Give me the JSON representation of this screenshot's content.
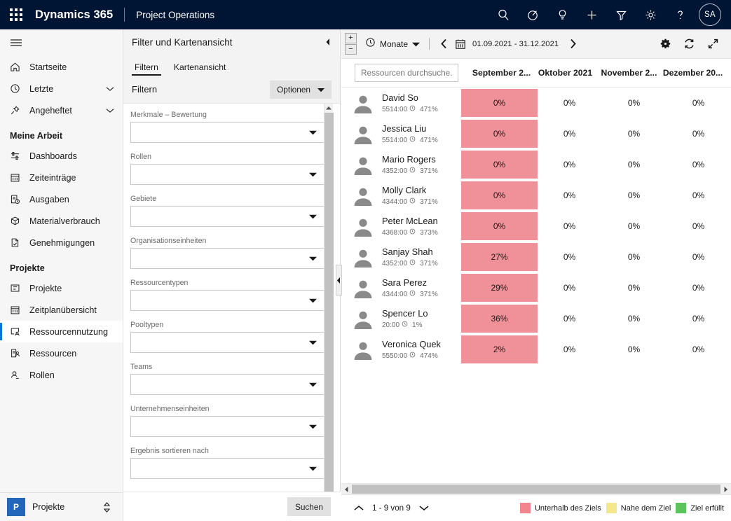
{
  "topbar": {
    "waffle_icon": "app-launcher-icon",
    "brand": "Dynamics 365",
    "app_name": "Project Operations",
    "icons": [
      {
        "name": "search-icon"
      },
      {
        "name": "diagnostics-icon"
      },
      {
        "name": "lightbulb-icon"
      },
      {
        "name": "plus-icon"
      },
      {
        "name": "filter-icon"
      },
      {
        "name": "gear-icon"
      },
      {
        "name": "help-icon"
      }
    ],
    "avatar_initials": "SA"
  },
  "sidebar": {
    "hamburger_icon": "hamburger-icon",
    "top_items": [
      {
        "label": "Startseite",
        "icon": "home-icon",
        "chevron": false,
        "selected": false
      },
      {
        "label": "Letzte",
        "icon": "clock-icon",
        "chevron": true,
        "selected": false
      },
      {
        "label": "Angeheftet",
        "icon": "pin-icon",
        "chevron": true,
        "selected": false
      }
    ],
    "group_my_work": "Meine Arbeit",
    "my_work_items": [
      {
        "label": "Dashboards",
        "icon": "dashboard-icon",
        "selected": false
      },
      {
        "label": "Zeiteinträge",
        "icon": "calendar-icon",
        "selected": false
      },
      {
        "label": "Ausgaben",
        "icon": "expense-icon",
        "selected": false
      },
      {
        "label": "Materialverbrauch",
        "icon": "package-icon",
        "selected": false
      },
      {
        "label": "Genehmigungen",
        "icon": "approval-icon",
        "selected": false
      }
    ],
    "group_projects": "Projekte",
    "project_items": [
      {
        "label": "Projekte",
        "icon": "project-icon",
        "selected": false
      },
      {
        "label": "Zeitplanübersicht",
        "icon": "calendar-icon",
        "selected": false
      },
      {
        "label": "Ressourcennutzung",
        "icon": "resource-utilization-icon",
        "selected": true
      },
      {
        "label": "Ressourcen",
        "icon": "resources-icon",
        "selected": false
      },
      {
        "label": "Rollen",
        "icon": "roles-icon",
        "selected": false
      }
    ],
    "footer": {
      "badge": "P",
      "label": "Projekte",
      "switch_icon": "app-switcher-icon"
    }
  },
  "filter_panel": {
    "title": "Filter und Kartenansicht",
    "collapse_icon": "collapse-left-icon",
    "tabs": [
      {
        "label": "Filtern",
        "active": true
      },
      {
        "label": "Kartenansicht",
        "active": false
      }
    ],
    "section_label": "Filtern",
    "options_button": "Optionen",
    "options_chevron_icon": "chevron-down-icon",
    "fields": [
      {
        "label": "Merkmale – Bewertung",
        "value": ""
      },
      {
        "label": "Rollen",
        "value": ""
      },
      {
        "label": "Gebiete",
        "value": ""
      },
      {
        "label": "Organisationseinheiten",
        "value": ""
      },
      {
        "label": "Ressourcentypen",
        "value": ""
      },
      {
        "label": "Pooltypen",
        "value": ""
      },
      {
        "label": "Teams",
        "value": ""
      },
      {
        "label": "Unternehmenseinheiten",
        "value": ""
      },
      {
        "label": "Ergebnis sortieren nach",
        "value": ""
      }
    ],
    "search_button": "Suchen"
  },
  "splitter": {
    "icon": "panel-collapse-handle-icon"
  },
  "grid_toolbar": {
    "zoom_in": "+",
    "zoom_out": "−",
    "scale_icon": "clock-icon",
    "scale_label": "Monate",
    "scale_chevron_icon": "chevron-down-icon",
    "prev_icon": "chevron-left-icon",
    "calendar_icon": "calendar-icon",
    "date_range": "01.09.2021 - 31.12.2021",
    "next_icon": "chevron-right-icon",
    "settings_icon": "gear-icon",
    "refresh_icon": "refresh-icon",
    "expand_icon": "fullscreen-icon"
  },
  "grid": {
    "search_placeholder": "Ressourcen durchsuche...",
    "columns": [
      "September 2...",
      "Oktober 2021",
      "November 2...",
      "Dezember 20..."
    ],
    "rows": [
      {
        "name": "David So",
        "hours": "5514:00",
        "pct": "471%",
        "values": [
          "0%",
          "0%",
          "0%",
          "0%"
        ],
        "highlight": [
          true,
          false,
          false,
          false
        ]
      },
      {
        "name": "Jessica Liu",
        "hours": "5514:00",
        "pct": "471%",
        "values": [
          "0%",
          "0%",
          "0%",
          "0%"
        ],
        "highlight": [
          true,
          false,
          false,
          false
        ]
      },
      {
        "name": "Mario Rogers",
        "hours": "4352:00",
        "pct": "371%",
        "values": [
          "0%",
          "0%",
          "0%",
          "0%"
        ],
        "highlight": [
          true,
          false,
          false,
          false
        ]
      },
      {
        "name": "Molly Clark",
        "hours": "4344:00",
        "pct": "371%",
        "values": [
          "0%",
          "0%",
          "0%",
          "0%"
        ],
        "highlight": [
          true,
          false,
          false,
          false
        ]
      },
      {
        "name": "Peter McLean",
        "hours": "4368:00",
        "pct": "373%",
        "values": [
          "0%",
          "0%",
          "0%",
          "0%"
        ],
        "highlight": [
          true,
          false,
          false,
          false
        ]
      },
      {
        "name": "Sanjay Shah",
        "hours": "4352:00",
        "pct": "371%",
        "values": [
          "27%",
          "0%",
          "0%",
          "0%"
        ],
        "highlight": [
          true,
          false,
          false,
          false
        ]
      },
      {
        "name": "Sara Perez",
        "hours": "4344:00",
        "pct": "371%",
        "values": [
          "29%",
          "0%",
          "0%",
          "0%"
        ],
        "highlight": [
          true,
          false,
          false,
          false
        ]
      },
      {
        "name": "Spencer Lo",
        "hours": "20:00",
        "pct": "1%",
        "values": [
          "36%",
          "0%",
          "0%",
          "0%"
        ],
        "highlight": [
          true,
          false,
          false,
          false
        ]
      },
      {
        "name": "Veronica Quek",
        "hours": "5550:00",
        "pct": "474%",
        "values": [
          "2%",
          "0%",
          "0%",
          "0%"
        ],
        "highlight": [
          true,
          false,
          false,
          false
        ]
      }
    ]
  },
  "status_bar": {
    "up_icon": "chevron-up-icon",
    "pager_text": "1 - 9 von 9",
    "down_icon": "chevron-down-icon",
    "legend": [
      {
        "label": "Unterhalb des Ziels",
        "color": "#F4848E"
      },
      {
        "label": "Nahe dem Ziel",
        "color": "#F5E78B"
      },
      {
        "label": "Ziel erfüllt",
        "color": "#5BC45B"
      }
    ]
  },
  "colors": {
    "topbar_bg": "#001433",
    "accent": "#0078d4",
    "below_target": "#F09098",
    "sidebar_bg": "#f6f6f6"
  }
}
